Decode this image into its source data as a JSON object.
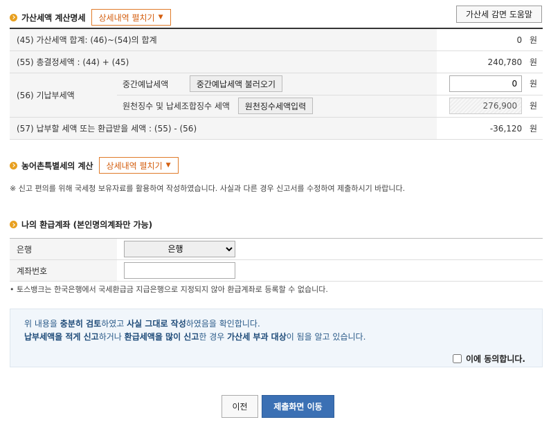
{
  "section1": {
    "title": "가산세액 계산명세",
    "expand_label": "상세내역 펼치기",
    "help_label": "가산세 감면 도움말"
  },
  "calc_rows": {
    "r45": {
      "label": "(45) 가산세액 합계: (46)~(54)의 합계",
      "value": "0",
      "unit": "원"
    },
    "r55": {
      "label": "(55) 총결정세액 : (44) + (45)",
      "value": "240,780",
      "unit": "원"
    },
    "r56": {
      "label": "(56) 기납부세액",
      "interim": {
        "label": "중간예납세액",
        "button": "중간예납세액 불러오기",
        "value": "0",
        "unit": "원"
      },
      "withholding": {
        "label": "원천징수 및 납세조합징수 세액",
        "button": "원천징수세액입력",
        "value": "276,900",
        "unit": "원"
      }
    },
    "r57": {
      "label": "(57) 납부할 세액 또는 환급받을 세액 : (55) - (56)",
      "value": "-36,120",
      "unit": "원"
    }
  },
  "section2": {
    "title": "농어촌특별세의 계산",
    "expand_label": "상세내역 펼치기"
  },
  "notice": "※ 신고 편의를 위해 국세청 보유자료를 활용하여 작성하였습니다. 사실과 다른 경우 신고서를 수정하여 제출하시기 바랍니다.",
  "section3": {
    "title": "나의 환급계좌 (본인명의계좌만 가능)"
  },
  "bank": {
    "bank_label": "은행",
    "bank_selected": "은행",
    "account_label": "계좌번호",
    "account_value": ""
  },
  "toss_note": "• 토스뱅크는 한국은행에서 국세환급금 지급은행으로 지정되지 않아 환급계좌로 등록할 수 없습니다.",
  "confirm": {
    "line1": {
      "t1": "위 내용을 ",
      "b1": "충분히 검토",
      "t2": "하였고 ",
      "b2": "사실 그대로 작성",
      "t3": "하였음을 확인합니다."
    },
    "line2": {
      "b1": "납부세액을 적게 신고",
      "t1": "하거나 ",
      "b2": "환급세액을 많이 신고",
      "t2": "한 경우 ",
      "b3": "가산세 부과 대상",
      "t3": "이 됨을 알고 있습니다."
    },
    "agree_label": "이에 동의합니다."
  },
  "buttons": {
    "prev": "이전",
    "submit": "제출화면 이동"
  },
  "colors": {
    "accent_orange": "#e07a28",
    "submit_blue": "#3b70b4",
    "confirm_bg": "#f1f6fb"
  }
}
